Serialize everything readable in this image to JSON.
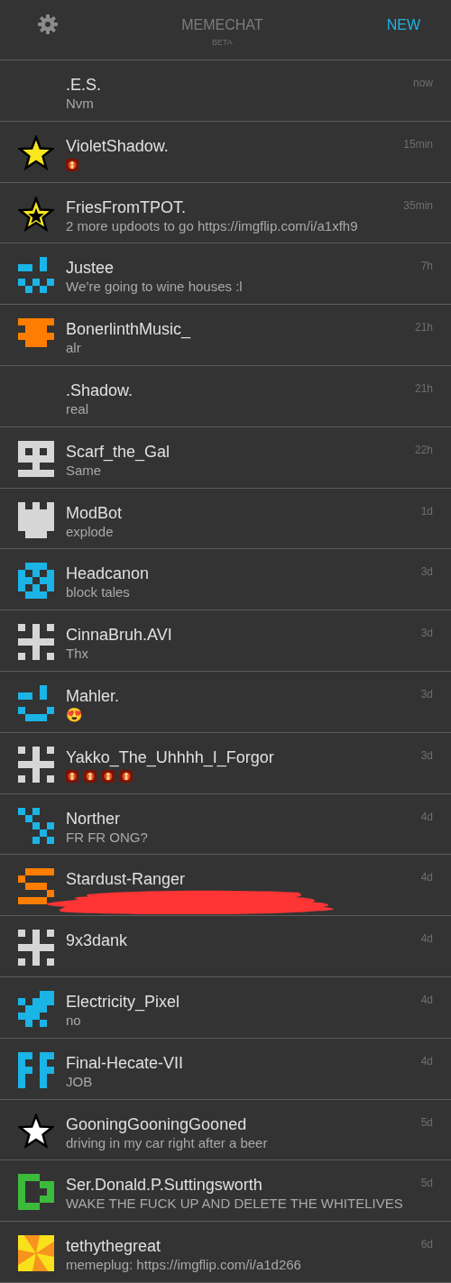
{
  "header": {
    "title": "MEMECHAT",
    "subtitle": "BETA",
    "new_button": "NEW"
  },
  "chats": [
    {
      "name": ".E.S.",
      "preview": "Nvm",
      "time": "now",
      "avatar": {
        "kind": "none"
      }
    },
    {
      "name": "VioletShadow.",
      "preview_icons": [
        {
          "kind": "glow"
        }
      ],
      "time": "15min",
      "avatar": {
        "kind": "star"
      }
    },
    {
      "name": "FriesFromTPOT.",
      "preview": "2 more updoots to go https://imgflip.com/i/a1xfh9",
      "time": "35min",
      "avatar": {
        "kind": "hollow-star"
      }
    },
    {
      "name": "Justee",
      "preview": "We’re going to wine houses :l",
      "time": "7h",
      "avatar": {
        "kind": "steps",
        "color": "#1ab4e6"
      }
    },
    {
      "name": "BonerlinthMusic_",
      "preview": "alr",
      "time": "21h",
      "avatar": {
        "kind": "bone",
        "color": "#ff7d00"
      }
    },
    {
      "name": ".Shadow.",
      "preview": "real",
      "time": "21h",
      "avatar": {
        "kind": "none"
      }
    },
    {
      "name": "Scarf_the_Gal",
      "preview": "Same",
      "time": "22h",
      "avatar": {
        "kind": "face",
        "color": "#d6d6d6"
      }
    },
    {
      "name": "ModBot",
      "preview": "explode",
      "time": "1d",
      "avatar": {
        "kind": "tower",
        "color": "#d6d6d6"
      }
    },
    {
      "name": "Headcanon",
      "preview": "block tales",
      "time": "3d",
      "avatar": {
        "kind": "checker",
        "color": "#1ab4e6"
      }
    },
    {
      "name": "CinnaBruh.AVI",
      "preview": "Thx",
      "time": "3d",
      "avatar": {
        "kind": "cross",
        "color": "#d6d6d6"
      }
    },
    {
      "name": "Mahler.",
      "preview": "😍",
      "time": "3d",
      "avatar": {
        "kind": "smile",
        "color": "#1ab4e6"
      }
    },
    {
      "name": "Yakko_The_Uhhhh_I_Forgor",
      "preview_icons": [
        {
          "kind": "glow"
        },
        {
          "kind": "glow"
        },
        {
          "kind": "glow"
        },
        {
          "kind": "glow"
        }
      ],
      "time": "3d",
      "avatar": {
        "kind": "cross",
        "color": "#d6d6d6"
      }
    },
    {
      "name": "Norther",
      "preview": "FR FR ONG?",
      "time": "4d",
      "avatar": {
        "kind": "diagonal",
        "color": "#1ab4e6"
      }
    },
    {
      "name": "Stardust-Ranger",
      "redacted": true,
      "time": "4d",
      "avatar": {
        "kind": "snake",
        "color": "#ff7d00"
      }
    },
    {
      "name": "9x3dank",
      "time": "4d",
      "avatar": {
        "kind": "cross",
        "color": "#d6d6d6"
      }
    },
    {
      "name": "Electricity_Pixel",
      "preview": "no",
      "time": "4d",
      "avatar": {
        "kind": "bolt",
        "color": "#1ab4e6"
      }
    },
    {
      "name": "Final-Hecate-VII",
      "preview": "JOB",
      "time": "4d",
      "avatar": {
        "kind": "double-f",
        "color": "#1ab4e6"
      }
    },
    {
      "name": "GooningGooningGooned",
      "preview": "driving in my car right after a beer",
      "time": "5d",
      "avatar": {
        "kind": "white-star"
      }
    },
    {
      "name": "Ser.Donald.P.Suttingsworth",
      "preview": "WAKE THE FUCK UP AND DELETE THE WHITELIVES",
      "time": "5d",
      "avatar": {
        "kind": "plug",
        "color": "#3cba3c"
      }
    },
    {
      "name": "tethythegreat",
      "preview": "memeplug: https://imgflip.com/i/a1d266",
      "time": "6d",
      "avatar": {
        "kind": "sunburst"
      }
    }
  ]
}
